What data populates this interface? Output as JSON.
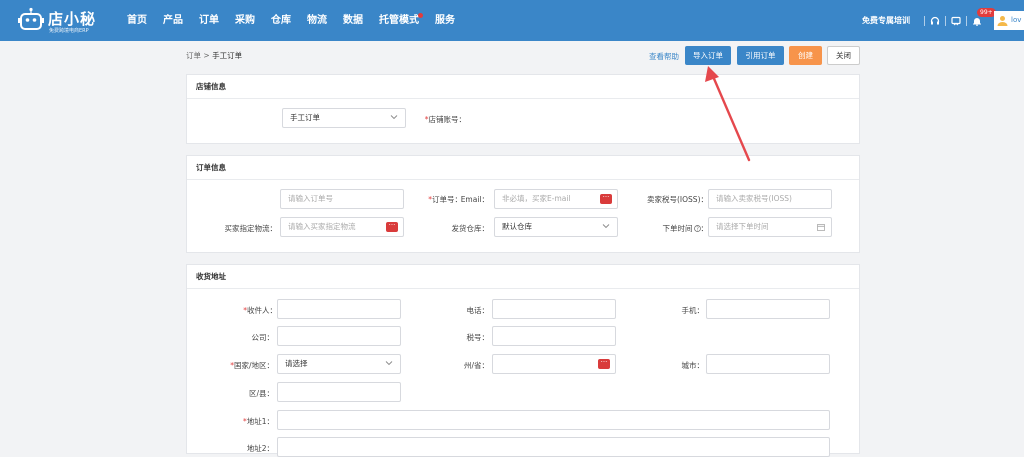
{
  "app": {
    "logo_text": "店小秘",
    "logo_sub": "免费跨境电商ERP"
  },
  "nav": [
    {
      "label": "首页"
    },
    {
      "label": "产品"
    },
    {
      "label": "订单"
    },
    {
      "label": "采购"
    },
    {
      "label": "仓库"
    },
    {
      "label": "物流"
    },
    {
      "label": "数据"
    },
    {
      "label": "托管模式"
    },
    {
      "label": "服务"
    }
  ],
  "topbar": {
    "training": "免费专属培训",
    "badge": "99+",
    "user": "lov"
  },
  "breadcrumb": {
    "parent": "订单",
    "sep": ">",
    "current": "手工订单"
  },
  "actions": {
    "help": "查看帮助",
    "import": "导入订单",
    "reference": "引用订单",
    "create": "创建",
    "close": "关闭"
  },
  "shop": {
    "title": "店铺信息",
    "account_label": "店铺账号：",
    "account_value": "手工订单"
  },
  "order": {
    "title": "订单信息",
    "order_no_label": "订单号：",
    "order_no_placeholder": "请输入订单号",
    "email_label": "Email：",
    "email_placeholder": "非必填，买家E-mail",
    "ioss_label": "卖家税号(IOSS)：",
    "ioss_placeholder": "请输入卖家税号(IOSS)",
    "logistics_label": "买家指定物流：",
    "logistics_placeholder": "请输入买家指定物流",
    "warehouse_label": "发货仓库：",
    "warehouse_value": "默认仓库",
    "time_label": "下单时间",
    "time_placeholder": "请选择下单时间"
  },
  "address": {
    "title": "收货地址",
    "receiver_label": "收件人：",
    "phone_label": "电话：",
    "mobile_label": "手机：",
    "company_label": "公司：",
    "taxno_label": "税号：",
    "country_label": "国家/地区：",
    "country_placeholder": "请选择",
    "state_label": "州/省：",
    "city_label": "城市：",
    "district_label": "区/县：",
    "addr1_label": "地址1：",
    "addr2_label": "地址2："
  },
  "colors": {
    "header": "#3a86c8",
    "primary": "#3a86c8",
    "create": "#f7944b",
    "required": "#e23c3c",
    "arrow": "#e5484d"
  }
}
